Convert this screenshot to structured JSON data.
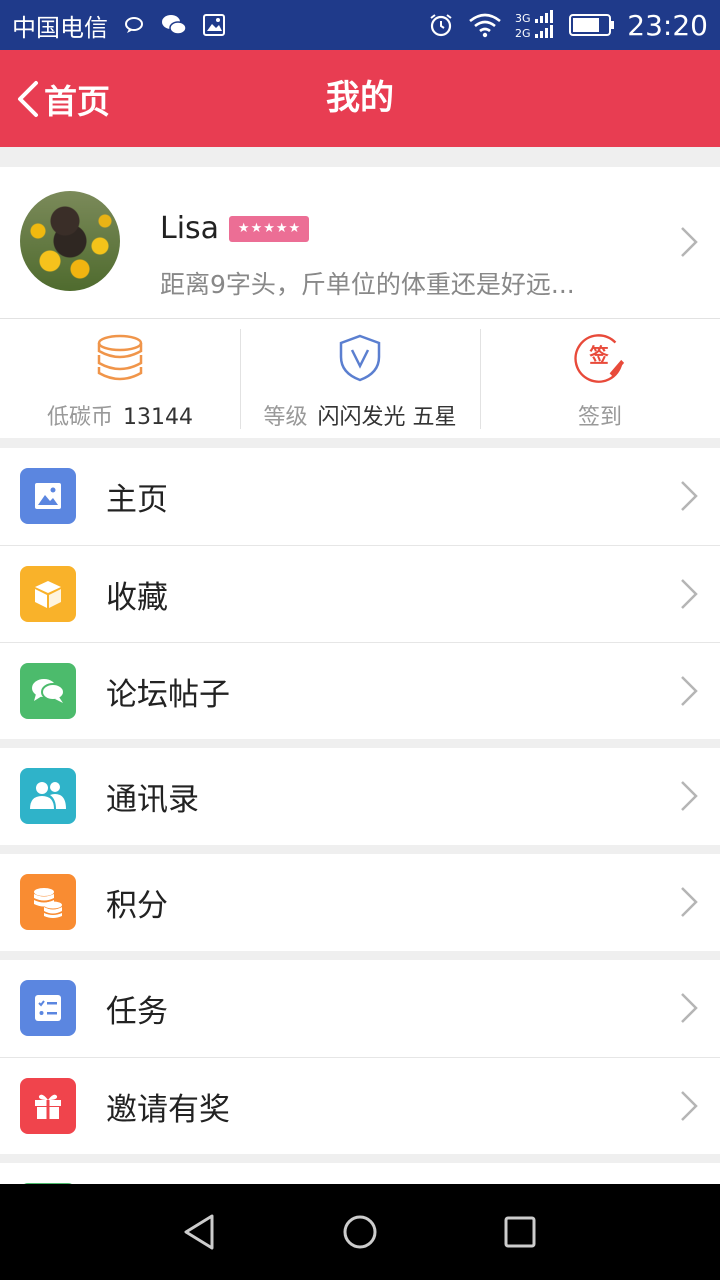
{
  "status_bar": {
    "carrier": "中国电信",
    "network": "3G 2G",
    "time": "23:20"
  },
  "header": {
    "back_label": "首页",
    "title": "我的"
  },
  "profile": {
    "name": "Lisa",
    "badge_stars": 5,
    "signature": "距离9字头，斤单位的体重还是好远..."
  },
  "stats": [
    {
      "label": "低碳币",
      "value": "13144",
      "icon": "coins-icon",
      "color": "#f0954a"
    },
    {
      "label": "等级",
      "value": "闪闪发光 五星",
      "icon": "shield-v-icon",
      "color": "#5b7fd0"
    },
    {
      "label": "签到",
      "value": "",
      "icon": "sign-in-icon",
      "color": "#e84a3a",
      "icon_char": "签"
    }
  ],
  "menu_groups": [
    [
      {
        "label": "主页",
        "icon": "image-icon",
        "color": "#5b86e0"
      },
      {
        "label": "收藏",
        "icon": "box-icon",
        "color": "#f9b22a"
      },
      {
        "label": "论坛帖子",
        "icon": "chat-icon",
        "color": "#4cbb6c"
      }
    ],
    [
      {
        "label": "通讯录",
        "icon": "contacts-icon",
        "color": "#2fb3c9"
      }
    ],
    [
      {
        "label": "积分",
        "icon": "points-icon",
        "color": "#f98c32"
      }
    ],
    [
      {
        "label": "任务",
        "icon": "task-list-icon",
        "color": "#5b86e0"
      },
      {
        "label": "邀请有奖",
        "icon": "gift-icon",
        "color": "#f0444c"
      }
    ]
  ]
}
